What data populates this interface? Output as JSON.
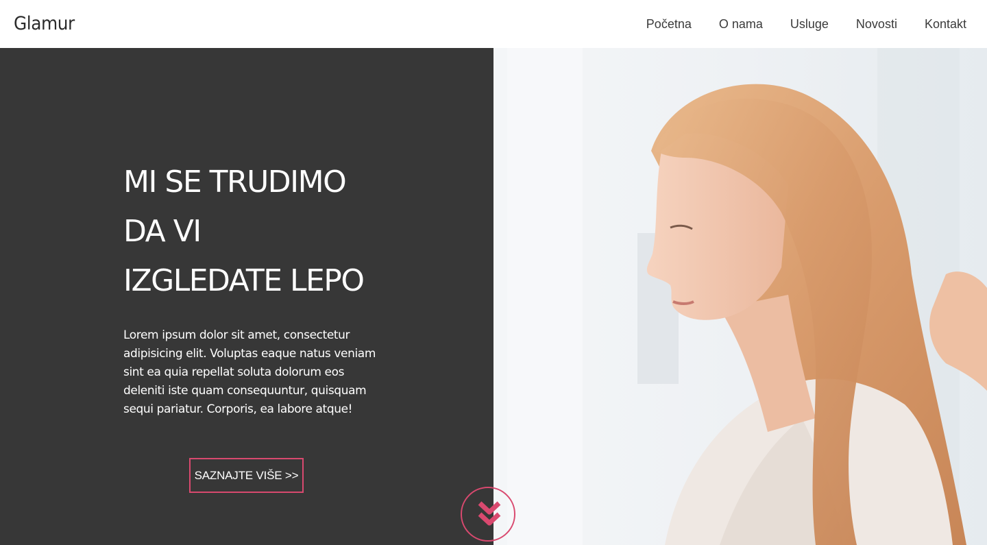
{
  "brand": {
    "logo": "Glamur",
    "accent_color": "#d9496f",
    "dark_panel_color": "#373737"
  },
  "nav": {
    "items": [
      {
        "label": "Početna"
      },
      {
        "label": "O nama"
      },
      {
        "label": "Usluge"
      },
      {
        "label": "Novosti"
      },
      {
        "label": "Kontakt"
      }
    ]
  },
  "hero": {
    "title_lines": [
      "MI SE TRUDIMO",
      "DA VI",
      "IZGLEDATE LEPO"
    ],
    "text": "Lorem ipsum dolor sit amet, consectetur adipisicing elit. Voluptas eaque natus veniam sint ea quia repellat soluta dolorum eos deleniti iste quam consequuntur, quisquam sequi pariatur. Corporis, ea labore atque!",
    "button_label": "SAZNAJTE VIŠE >>",
    "image": "woman-with-long-blonde-hair-photo",
    "scroll_icon": "double-chevron-down-icon"
  }
}
